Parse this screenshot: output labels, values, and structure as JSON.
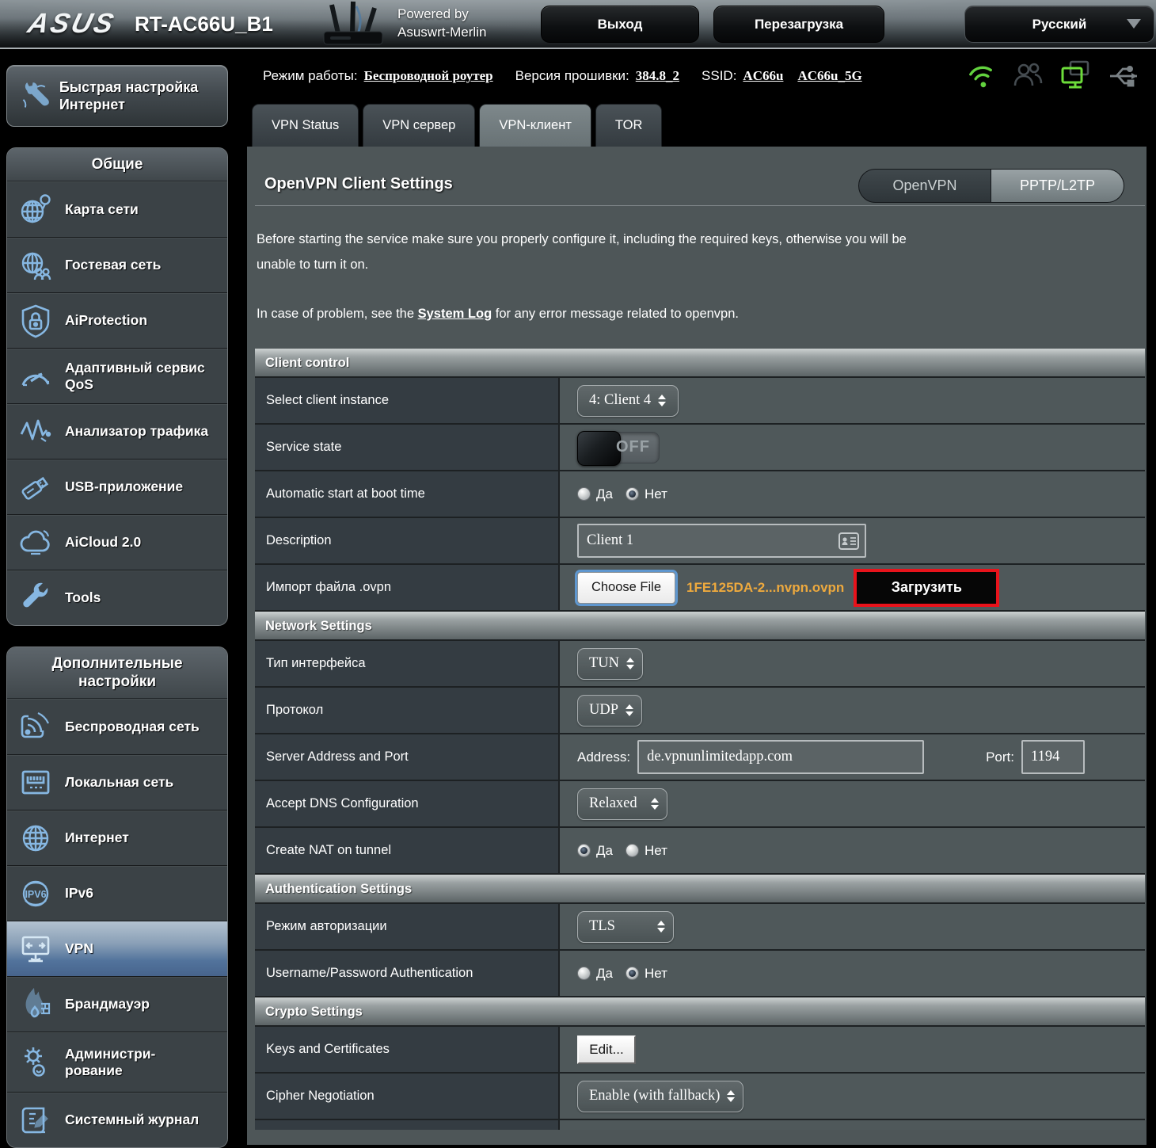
{
  "header": {
    "brand": "ASUS",
    "model": "RT-AC66U_B1",
    "powered_by_line1": "Powered by",
    "powered_by_line2": "Asuswrt-Merlin",
    "logout_button": "Выход",
    "reboot_button": "Перезагрузка",
    "language_selector": "Русский"
  },
  "statusbar": {
    "mode_label": "Режим работы:",
    "mode_value": "Беспроводной роутер",
    "firmware_label": "Версия прошивки:",
    "firmware_value": "384.8_2",
    "ssid_label": "SSID:",
    "ssid_1": "AC66u",
    "ssid_2": "AC66u_5G",
    "icons": [
      "wifi-icon",
      "clients-icon",
      "lan-devices-icon",
      "usb-icon"
    ]
  },
  "sidebar": {
    "quick_setup_label": "Быстрая настройка Интернет",
    "sections": [
      {
        "title": "Общие",
        "items": [
          {
            "label": "Карта сети",
            "icon": "network-map-icon"
          },
          {
            "label": "Гостевая сеть",
            "icon": "guest-network-icon"
          },
          {
            "label": "AiProtection",
            "icon": "aiprotection-icon"
          },
          {
            "label": "Адаптивный сервис QoS",
            "icon": "qos-icon"
          },
          {
            "label": "Анализатор трафика",
            "icon": "traffic-analyzer-icon"
          },
          {
            "label": "USB-приложение",
            "icon": "usb-application-icon"
          },
          {
            "label": "AiCloud 2.0",
            "icon": "aicloud-icon"
          },
          {
            "label": "Tools",
            "icon": "tools-icon"
          }
        ]
      },
      {
        "title": "Дополнительные настройки",
        "items": [
          {
            "label": "Беспроводная сеть",
            "icon": "wireless-icon"
          },
          {
            "label": "Локальная сеть",
            "icon": "lan-icon"
          },
          {
            "label": "Интернет",
            "icon": "internet-icon"
          },
          {
            "label": "IPv6",
            "icon": "ipv6-icon"
          },
          {
            "label": "VPN",
            "icon": "vpn-icon",
            "selected": true
          },
          {
            "label": "Брандмауэр",
            "icon": "firewall-icon"
          },
          {
            "label_line1": "Администри-",
            "label_line2": "рование",
            "icon": "admin-icon"
          },
          {
            "label": "Системный журнал",
            "icon": "syslog-icon"
          }
        ]
      }
    ]
  },
  "tabs": [
    "VPN Status",
    "VPN сервер",
    "VPN-клиент",
    "TOR"
  ],
  "active_tab": "VPN-клиент",
  "common": {
    "yes": "Да",
    "no": "Нет"
  },
  "main": {
    "title": "OpenVPN Client Settings",
    "vpn_type": {
      "openvpn": "OpenVPN",
      "pptp": "PPTP/L2TP"
    },
    "intro1": "Before starting the service make sure you properly configure it, including the required keys, otherwise you will be unable to turn it on.",
    "intro2_prefix": "In case of problem, see the ",
    "intro2_link": "System Log",
    "intro2_suffix": " for any error message related to openvpn.",
    "client_control": {
      "title": "Client control",
      "instance_label": "Select client instance",
      "instance_value": "4: Client 4",
      "service_state_label": "Service state",
      "service_state_value": "OFF",
      "auto_start_label": "Automatic start at boot time",
      "description_label": "Description",
      "description_value": "Client 1",
      "import_label": "Импорт файла .ovpn",
      "choose_file_button": "Choose File",
      "file_name": "1FE125DA-2...nvpn.ovpn",
      "upload_button": "Загрузить"
    },
    "network_settings": {
      "title": "Network Settings",
      "interface_type_label": "Тип интерфейса",
      "interface_type_value": "TUN",
      "protocol_label": "Протокол",
      "protocol_value": "UDP",
      "server_label": "Server Address and Port",
      "address_label": "Address:",
      "address_value": "de.vpnunlimitedapp.com",
      "port_label": "Port:",
      "port_value": "1194",
      "dns_label": "Accept DNS Configuration",
      "dns_value": "Relaxed",
      "nat_label": "Create NAT on tunnel"
    },
    "auth_settings": {
      "title": "Authentication Settings",
      "auth_mode_label": "Режим авторизации",
      "auth_mode_value": "TLS",
      "userpass_label": "Username/Password Authentication"
    },
    "crypto_settings": {
      "title": "Crypto Settings",
      "keys_label": "Keys and Certificates",
      "edit_button": "Edit...",
      "cipher_label": "Cipher Negotiation",
      "cipher_value": "Enable (with fallback)"
    }
  },
  "colors": {
    "status_green": "#62d23e",
    "file_name_orange": "#eda93e",
    "highlight_red": "#e8131b",
    "selected_item_blue": "#47648c",
    "sidebar_icon_blue": "#86b7e2"
  }
}
